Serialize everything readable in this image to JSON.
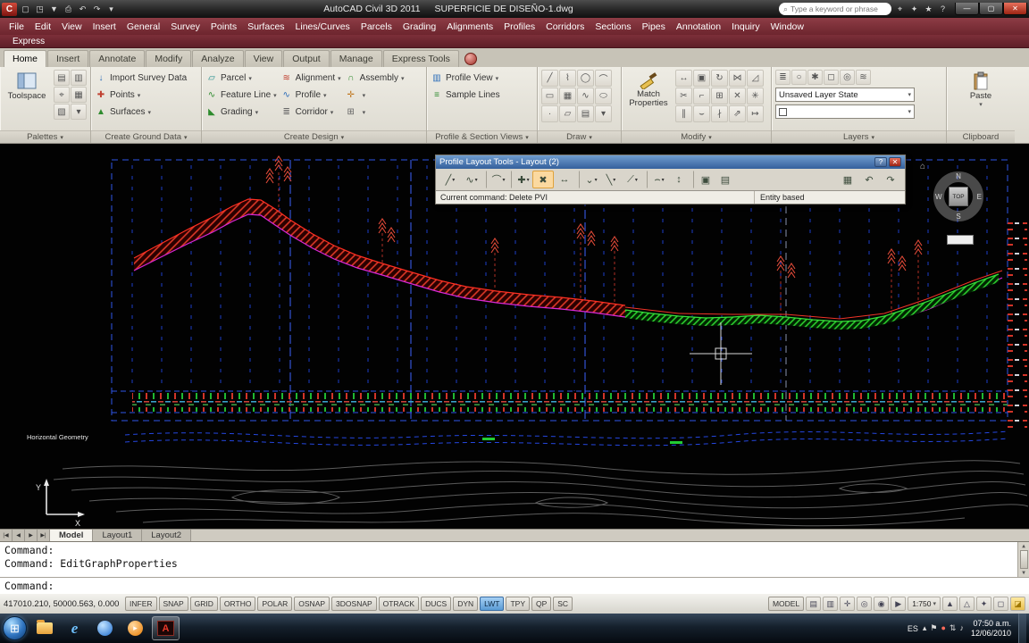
{
  "titlebar": {
    "app_title": "AutoCAD Civil 3D 2011",
    "doc_title": "SUPERFICIE DE DISEÑO-1.dwg",
    "search_placeholder": "Type a keyword or phrase",
    "right_icons": [
      {
        "name": "search-binoculars-icon",
        "g": "⌖"
      },
      {
        "name": "communication-center-icon",
        "g": "✦"
      },
      {
        "name": "favorites-icon",
        "g": "★"
      },
      {
        "name": "help-icon",
        "g": "?"
      }
    ],
    "window_controls": [
      {
        "name": "minimize-button",
        "g": "—"
      },
      {
        "name": "maximize-button",
        "g": "▢"
      },
      {
        "name": "close-button",
        "g": "✕",
        "cls": "close"
      }
    ]
  },
  "quick_access": {
    "icons": [
      {
        "name": "qat-new-icon",
        "g": "▢"
      },
      {
        "name": "qat-open-icon",
        "g": "◳"
      },
      {
        "name": "qat-save-icon",
        "g": "▼"
      },
      {
        "name": "qat-plot-icon",
        "g": "⎙"
      },
      {
        "name": "qat-undo-icon",
        "g": "↶"
      },
      {
        "name": "qat-redo-icon",
        "g": "↷"
      },
      {
        "name": "qat-customize-icon",
        "g": "▾"
      }
    ]
  },
  "menubar": {
    "items": [
      "File",
      "Edit",
      "View",
      "Insert",
      "General",
      "Survey",
      "Points",
      "Surfaces",
      "Lines/Curves",
      "Parcels",
      "Grading",
      "Alignments",
      "Profiles",
      "Corridors",
      "Sections",
      "Pipes",
      "Annotation",
      "Inquiry",
      "Window"
    ]
  },
  "express_row": {
    "label": "Express"
  },
  "ribbon": {
    "tabs": [
      {
        "label": "Home",
        "cls": "active"
      },
      {
        "label": "Insert"
      },
      {
        "label": "Annotate"
      },
      {
        "label": "Modify"
      },
      {
        "label": "Analyze"
      },
      {
        "label": "View"
      },
      {
        "label": "Output"
      },
      {
        "label": "Manage"
      },
      {
        "label": "Express Tools"
      }
    ],
    "panels": {
      "palettes": {
        "label": "Palettes",
        "big_button": "Toolspace",
        "icons": [
          {
            "name": "properties-palette-icon",
            "g": "▤"
          },
          {
            "name": "panorama-palette-icon",
            "g": "▥"
          },
          {
            "name": "survey-palette-icon",
            "g": "⌖"
          },
          {
            "name": "tool-palettes-icon",
            "g": "▦"
          },
          {
            "name": "sheet-set-manager-icon",
            "g": "▧"
          },
          {
            "name": "more-palettes-icon",
            "g": "▾"
          }
        ]
      },
      "ground": {
        "label": "Create Ground Data",
        "items": [
          {
            "name": "import-survey-data-button",
            "g": "↓",
            "gc": "c-blue",
            "label": "Import Survey Data",
            "dd": ""
          },
          {
            "name": "points-button",
            "g": "✚",
            "gc": "c-red",
            "label": "Points",
            "dd": "▾"
          },
          {
            "name": "surfaces-button",
            "g": "▲",
            "gc": "c-green",
            "label": "Surfaces",
            "dd": "▾"
          }
        ]
      },
      "design": {
        "label": "Create Design",
        "col1": [
          {
            "name": "parcel-button",
            "g": "▱",
            "gc": "c-teal",
            "label": "Parcel",
            "dd": "▾"
          },
          {
            "name": "feature-line-button",
            "g": "∿",
            "gc": "c-green",
            "label": "Feature Line",
            "dd": "▾"
          },
          {
            "name": "grading-button",
            "g": "◣",
            "gc": "c-green",
            "label": "Grading",
            "dd": "▾"
          }
        ],
        "col2": [
          {
            "name": "alignment-button",
            "g": "≋",
            "gc": "c-red",
            "label": "Alignment",
            "dd": "▾"
          },
          {
            "name": "profile-button",
            "g": "∿",
            "gc": "c-blue",
            "label": "Profile",
            "dd": "▾"
          },
          {
            "name": "corridor-button",
            "g": "≣",
            "gc": "c-gray",
            "label": "Corridor",
            "dd": "▾"
          }
        ],
        "col3": [
          {
            "name": "assembly-button",
            "g": "∩",
            "gc": "c-green",
            "label": "Assembly",
            "dd": "▾"
          },
          {
            "name": "intersection-button",
            "g": "✛",
            "gc": "c-orange",
            "label": "",
            "dd": "▾"
          },
          {
            "name": "design-more-button",
            "g": "⊞",
            "gc": "c-gray",
            "label": "",
            "dd": "▾"
          }
        ]
      },
      "profile_views": {
        "label": "Profile & Section Views",
        "items": [
          {
            "name": "profile-view-button",
            "g": "▥",
            "gc": "c-blue",
            "label": "Profile View",
            "dd": "▾"
          },
          {
            "name": "sample-lines-button",
            "g": "≡",
            "gc": "c-green",
            "label": "Sample Lines",
            "dd": ""
          }
        ]
      },
      "draw": {
        "label": "Draw",
        "icons": [
          {
            "name": "line-icon",
            "g": "╱"
          },
          {
            "name": "polyline-icon",
            "g": "⌇"
          },
          {
            "name": "circle-icon",
            "g": "◯"
          },
          {
            "name": "arc-icon",
            "g": "⌒"
          },
          {
            "name": "rectangle-icon",
            "g": "▭"
          },
          {
            "name": "hatch-icon",
            "g": "▦"
          },
          {
            "name": "spline-icon",
            "g": "∿"
          },
          {
            "name": "ellipse-icon",
            "g": "⬭"
          },
          {
            "name": "point-icon",
            "g": "·"
          },
          {
            "name": "region-icon",
            "g": "▱"
          },
          {
            "name": "table-icon",
            "g": "▤"
          },
          {
            "name": "more-draw-icon",
            "g": "▾"
          }
        ]
      },
      "modify": {
        "label": "Modify",
        "big_button": "Match Properties",
        "icons": [
          {
            "name": "move-icon",
            "g": "↔"
          },
          {
            "name": "copy-icon",
            "g": "▣"
          },
          {
            "name": "rotate-icon",
            "g": "↻"
          },
          {
            "name": "mirror-icon",
            "g": "⋈"
          },
          {
            "name": "scale-icon",
            "g": "◿"
          },
          {
            "name": "trim-icon",
            "g": "✂"
          },
          {
            "name": "fillet-icon",
            "g": "⌐"
          },
          {
            "name": "array-icon",
            "g": "⊞"
          },
          {
            "name": "erase-icon",
            "g": "✕"
          },
          {
            "name": "explode-icon",
            "g": "✳"
          },
          {
            "name": "offset-icon",
            "g": "∥"
          },
          {
            "name": "join-icon",
            "g": "⌣"
          },
          {
            "name": "break-icon",
            "g": "∤"
          },
          {
            "name": "stretch-icon",
            "g": "⇗"
          },
          {
            "name": "lengthen-icon",
            "g": "↦"
          }
        ]
      },
      "layers": {
        "label": "Layers",
        "layer_state": "Unsaved Layer State",
        "icons": [
          {
            "name": "layer-properties-icon",
            "g": "≣"
          },
          {
            "name": "layer-off-icon",
            "g": "○"
          },
          {
            "name": "layer-freeze-icon",
            "g": "✱"
          },
          {
            "name": "layer-lock-icon",
            "g": "◻"
          },
          {
            "name": "layer-isolate-icon",
            "g": "◎"
          },
          {
            "name": "layer-match-icon",
            "g": "≋"
          }
        ]
      },
      "clipboard": {
        "label": "Clipboard",
        "big_button": "Paste"
      }
    }
  },
  "floating_toolbar": {
    "title": "Profile Layout Tools - Layout (2)",
    "status_left": "Current command: Delete PVI",
    "status_right": "Entity based",
    "window_buttons": [
      {
        "name": "toolbar-help-button",
        "g": "?"
      },
      {
        "name": "toolbar-close-button",
        "g": "✕",
        "cls": "close"
      }
    ],
    "tools": [
      {
        "name": "draw-tangents-button",
        "g": "╱",
        "cls": "has-dd"
      },
      {
        "name": "draw-tangents-with-curves-button",
        "g": "∿",
        "cls": "has-dd"
      },
      {
        "name": "curve-settings-button",
        "g": "⌒",
        "cls": "has-dd sep"
      },
      {
        "name": "insert-pvi-button",
        "g": "✚",
        "cls": "sep has-dd"
      },
      {
        "name": "delete-pvi-button",
        "g": "✖",
        "cls": "active"
      },
      {
        "name": "move-pvi-button",
        "g": "↔"
      },
      {
        "name": "pvi-based-button",
        "g": "⌄",
        "cls": "has-dd sep"
      },
      {
        "name": "fixed-tangent-button",
        "g": "╲",
        "cls": "has-dd"
      },
      {
        "name": "float-tangent-button",
        "g": "⟋",
        "cls": "has-dd"
      },
      {
        "name": "free-vertical-curve-button",
        "g": "⌢",
        "cls": "has-dd sep"
      },
      {
        "name": "raise-lower-pvi-button",
        "g": "↕"
      },
      {
        "name": "copy-profile-button",
        "g": "▣",
        "cls": "sep"
      },
      {
        "name": "pvi-table-button",
        "g": "▤"
      },
      {
        "name": "profile-grid-view-button",
        "g": "▦",
        "cls": "right-group"
      },
      {
        "name": "undo-button",
        "g": "↶"
      },
      {
        "name": "redo-button",
        "g": "↷"
      }
    ]
  },
  "viewcube": {
    "north": "N",
    "south": "S",
    "east": "E",
    "west": "W",
    "top": "TOP"
  },
  "drawing": {
    "band_label": "Horizontal Geometry"
  },
  "layout_tabs": {
    "nav": [
      "|◀",
      "◀",
      "▶",
      "▶|"
    ],
    "tabs": [
      {
        "label": "Model",
        "cls": "active"
      },
      {
        "label": "Layout1"
      },
      {
        "label": "Layout2"
      }
    ]
  },
  "command_line": {
    "history": [
      "Command:",
      "Command: EditGraphProperties"
    ],
    "prompt": "Command:"
  },
  "status_bar": {
    "coords": "417010.210, 50000.563, 0.000",
    "toggles": [
      {
        "label": "INFER"
      },
      {
        "label": "SNAP"
      },
      {
        "label": "GRID"
      },
      {
        "label": "ORTHO"
      },
      {
        "label": "POLAR"
      },
      {
        "label": "OSNAP"
      },
      {
        "label": "3DOSNAP"
      },
      {
        "label": "OTRACK"
      },
      {
        "label": "DUCS"
      },
      {
        "label": "DYN"
      },
      {
        "label": "LWT",
        "cls": "on"
      },
      {
        "label": "TPY"
      },
      {
        "label": "QP"
      },
      {
        "label": "SC"
      }
    ],
    "model_label": "MODEL",
    "scale": "1:750",
    "right_icons": [
      {
        "name": "quick-view-layouts-icon",
        "g": "▤"
      },
      {
        "name": "quick-view-drawings-icon",
        "g": "▥"
      },
      {
        "name": "pan-icon",
        "g": "✛"
      },
      {
        "name": "zoom-icon",
        "g": "◎"
      },
      {
        "name": "steering-wheel-icon",
        "g": "◉"
      },
      {
        "name": "show-motion-icon",
        "g": "▶"
      }
    ],
    "trailing_icons": [
      {
        "name": "annotation-scale-icon",
        "g": "▲"
      },
      {
        "name": "annotation-visibility-icon",
        "g": "△"
      },
      {
        "name": "workspace-switching-icon",
        "g": "✦"
      },
      {
        "name": "toolbar-lock-icon",
        "g": "◻"
      },
      {
        "name": "clean-screen-icon",
        "g": "◪",
        "cls": "yellow"
      }
    ]
  },
  "taskbar": {
    "start_glyph": "⊞",
    "apps": [
      {
        "name": "folder-icon",
        "ic": "icon-folder",
        "g": ""
      },
      {
        "name": "internet-explorer-icon",
        "ic": "icon-ie",
        "g": "e"
      },
      {
        "name": "browser-icon",
        "ic": "icon-globe",
        "g": ""
      },
      {
        "name": "media-player-icon",
        "ic": "icon-wmp",
        "g": "▸"
      },
      {
        "name": "autocad-icon",
        "ic": "icon-acad",
        "g": "A",
        "cls": "active"
      }
    ],
    "tray_lang": "ES",
    "tray_icons": [
      {
        "name": "show-hidden-icons",
        "g": "▴"
      },
      {
        "name": "action-center-icon",
        "g": "⚑"
      },
      {
        "name": "update-icon",
        "g": "●",
        "cls": "red"
      },
      {
        "name": "network-icon",
        "g": "⇅"
      },
      {
        "name": "volume-icon",
        "g": "♪"
      }
    ],
    "time": "07:50 a.m.",
    "date": "12/06/2010"
  }
}
